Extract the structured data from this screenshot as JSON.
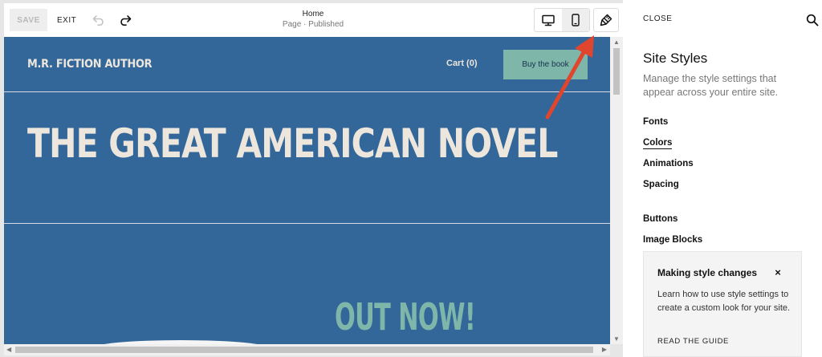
{
  "toolbar": {
    "save_label": "SAVE",
    "exit_label": "EXIT",
    "undo_icon": "undo-icon",
    "redo_icon": "redo-icon",
    "page_title": "Home",
    "page_status": "Page · Published",
    "desktop_icon": "desktop-icon",
    "mobile_icon": "mobile-icon",
    "site_styles_icon": "paintbrush-icon"
  },
  "site": {
    "title": "M.R. FICTION AUTHOR",
    "cart_label": "Cart (0)",
    "buy_button_label": "Buy the book",
    "hero_heading": "THE GREAT AMERICAN NOVEL",
    "out_now_text": "OUT NOW!",
    "colors": {
      "background": "#336699",
      "text": "#ece6dd",
      "accent": "#7fb6aa"
    }
  },
  "annotation": {
    "arrow_color": "#e0452d"
  },
  "panel": {
    "close_label": "CLOSE",
    "search_icon": "search-icon",
    "title": "Site Styles",
    "description": "Manage the style settings that appear across your entire site.",
    "items": [
      {
        "label": "Fonts",
        "active": false
      },
      {
        "label": "Colors",
        "active": true
      },
      {
        "label": "Animations",
        "active": false
      },
      {
        "label": "Spacing",
        "active": false
      },
      {
        "label": "Buttons",
        "active": false
      },
      {
        "label": "Image Blocks",
        "active": false
      }
    ],
    "tip": {
      "title": "Making style changes",
      "close_glyph": "×",
      "body": "Learn how to use style settings to create a custom look for your site.",
      "link_label": "READ THE GUIDE"
    }
  }
}
